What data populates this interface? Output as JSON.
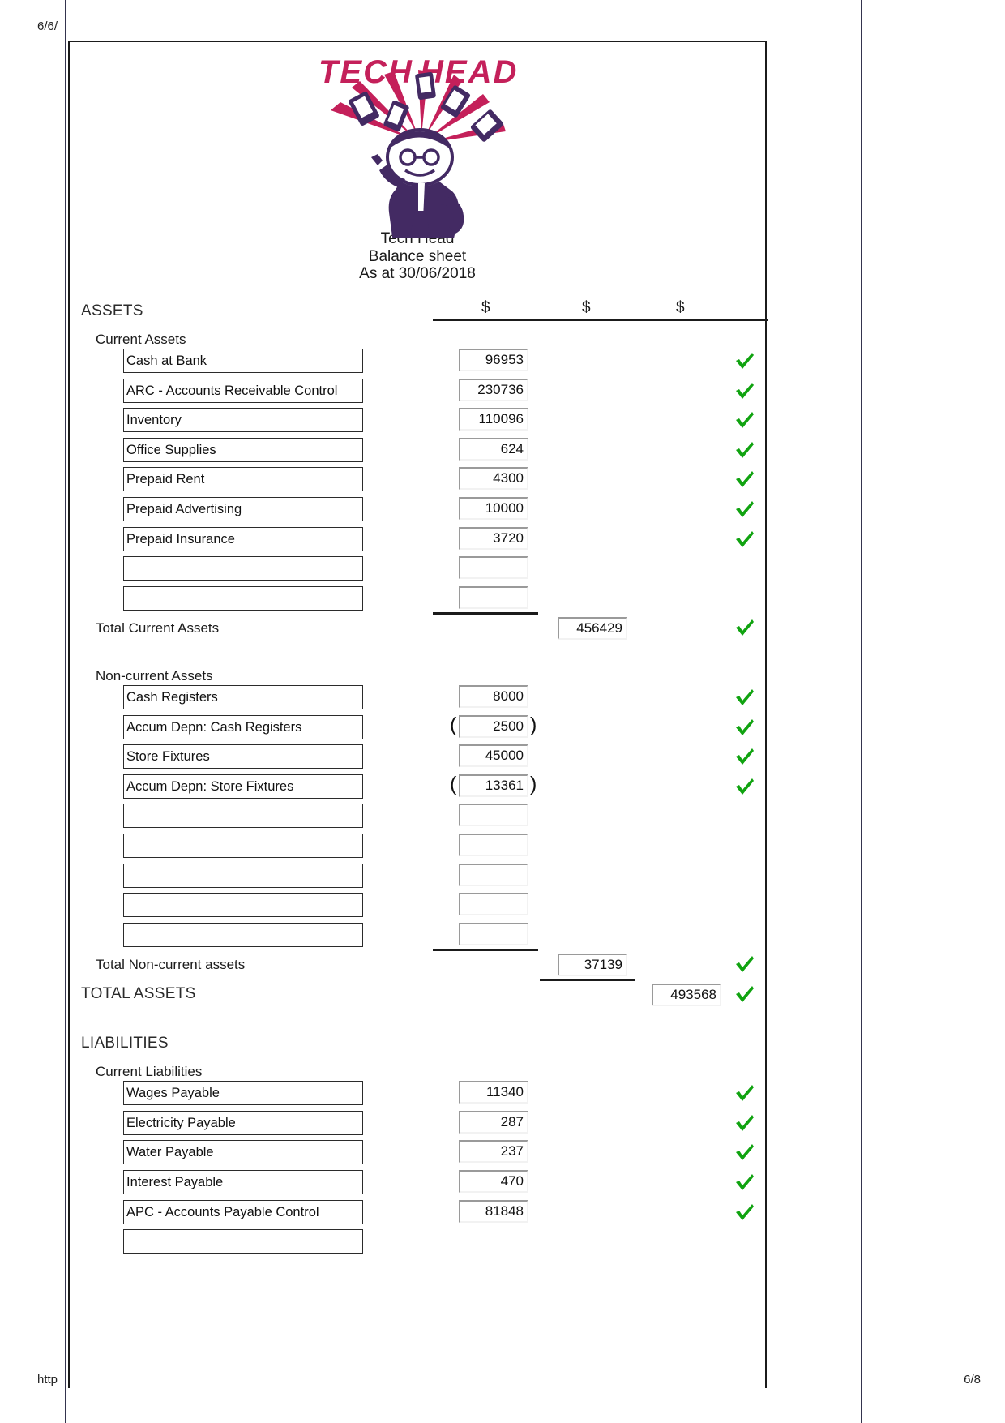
{
  "browser_chrome": {
    "header_left": "6/6/",
    "footer_left": "http",
    "footer_right": "6/8"
  },
  "document": {
    "logo_text": "Tech Head",
    "company": "Tech Head",
    "statement": "Balance sheet",
    "as_at": "As at 30/06/2018",
    "currency_headers": [
      "$",
      "$",
      "$"
    ],
    "tick_color": "#10a310",
    "logo_colors": {
      "wordmark": "#c4205a",
      "figure": "#432a63",
      "rays": "#c4205a"
    }
  },
  "sections": {
    "assets_heading": "ASSETS",
    "current_assets_heading": "Current Assets",
    "current_assets": [
      {
        "name": "Cash at Bank",
        "value": "96953",
        "tick": true,
        "negative": false
      },
      {
        "name": "ARC - Accounts Receivable Control",
        "value": "230736",
        "tick": true,
        "negative": false
      },
      {
        "name": "Inventory",
        "value": "110096",
        "tick": true,
        "negative": false
      },
      {
        "name": "Office Supplies",
        "value": "624",
        "tick": true,
        "negative": false
      },
      {
        "name": "Prepaid Rent",
        "value": "4300",
        "tick": true,
        "negative": false
      },
      {
        "name": "Prepaid Advertising",
        "value": "10000",
        "tick": true,
        "negative": false
      },
      {
        "name": "Prepaid Insurance",
        "value": "3720",
        "tick": true,
        "negative": false
      },
      {
        "name": "",
        "value": "",
        "tick": false,
        "negative": false
      },
      {
        "name": "",
        "value": "",
        "tick": false,
        "negative": false
      }
    ],
    "total_current_assets": {
      "label": "Total Current Assets",
      "value": "456429",
      "tick": true
    },
    "noncurrent_assets_heading": "Non-current Assets",
    "noncurrent_assets": [
      {
        "name": "Cash Registers",
        "value": "8000",
        "tick": true,
        "negative": false
      },
      {
        "name": "Accum Depn: Cash Registers",
        "value": "2500",
        "tick": true,
        "negative": true
      },
      {
        "name": "Store Fixtures",
        "value": "45000",
        "tick": true,
        "negative": false
      },
      {
        "name": "Accum Depn: Store Fixtures",
        "value": "13361",
        "tick": true,
        "negative": true
      },
      {
        "name": "",
        "value": "",
        "tick": false,
        "negative": false
      },
      {
        "name": "",
        "value": "",
        "tick": false,
        "negative": false
      },
      {
        "name": "",
        "value": "",
        "tick": false,
        "negative": false
      },
      {
        "name": "",
        "value": "",
        "tick": false,
        "negative": false
      },
      {
        "name": "",
        "value": "",
        "tick": false,
        "negative": false
      }
    ],
    "total_noncurrent_assets": {
      "label": "Total Non-current assets",
      "value": "37139",
      "tick": true
    },
    "total_assets": {
      "label": "TOTAL ASSETS",
      "value": "493568",
      "tick": true
    },
    "liabilities_heading": "LIABILITIES",
    "current_liabilities_heading": "Current Liabilities",
    "current_liabilities": [
      {
        "name": "Wages Payable",
        "value": "11340",
        "tick": true,
        "negative": false
      },
      {
        "name": "Electricity Payable",
        "value": "287",
        "tick": true,
        "negative": false
      },
      {
        "name": "Water Payable",
        "value": "237",
        "tick": true,
        "negative": false
      },
      {
        "name": "Interest Payable",
        "value": "470",
        "tick": true,
        "negative": false
      },
      {
        "name": "APC - Accounts Payable Control",
        "value": "81848",
        "tick": true,
        "negative": false
      },
      {
        "name": "",
        "value": "",
        "tick": false,
        "negative": false
      }
    ]
  }
}
